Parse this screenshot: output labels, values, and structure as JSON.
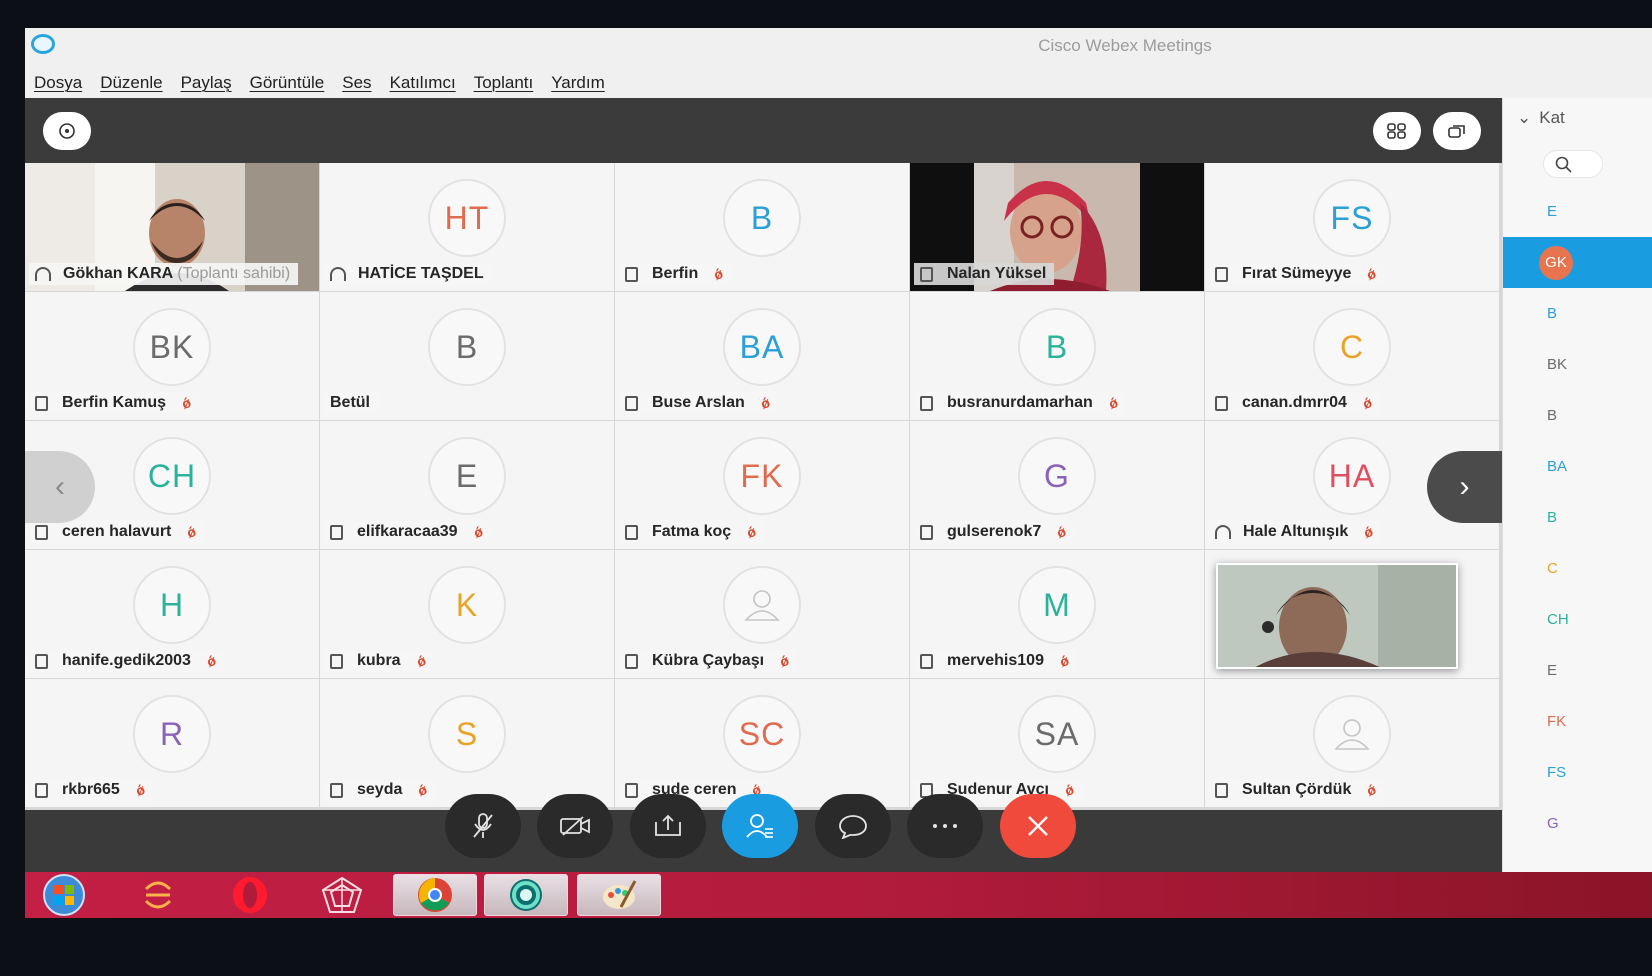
{
  "window": {
    "title": "Cisco Webex Meetings"
  },
  "menu": [
    "Dosya",
    "Düzenle",
    "Paylaş",
    "Görüntüle",
    "Ses",
    "Katılımcı",
    "Toplantı",
    "Yardım"
  ],
  "participants": [
    {
      "name": "Gökhan KARA",
      "note": "(Toplantı sahibi)",
      "kind": "video",
      "icon": "headset-icon",
      "muted": false
    },
    {
      "name": "HATİCE TAŞDEL",
      "initials": "HT",
      "color": "#e06b4f",
      "icon": "headset-icon",
      "muted": false
    },
    {
      "name": "Berfin",
      "initials": "B",
      "color": "#2b9fd6",
      "icon": "phone-icon",
      "muted": true
    },
    {
      "name": "Nalan Yüksel",
      "kind": "video",
      "icon": "phone-icon",
      "muted": false
    },
    {
      "name": "Fırat Sümeyye",
      "initials": "FS",
      "color": "#2b9fd6",
      "icon": "phone-icon",
      "muted": true
    },
    {
      "name": "Berfin Kamuş",
      "initials": "BK",
      "color": "#6b6b6b",
      "icon": "phone-icon",
      "muted": true
    },
    {
      "name": "Betül",
      "initials": "B",
      "color": "#6b6b6b",
      "icon": "",
      "muted": false
    },
    {
      "name": "Buse Arslan",
      "initials": "BA",
      "color": "#2b9fd6",
      "icon": "phone-icon",
      "muted": true
    },
    {
      "name": "busranurdamarhan",
      "initials": "B",
      "color": "#2bb39a",
      "icon": "phone-icon",
      "muted": true
    },
    {
      "name": "canan.dmrr04",
      "initials": "C",
      "color": "#e8a427",
      "icon": "phone-icon",
      "muted": true
    },
    {
      "name": "ceren halavurt",
      "initials": "CH",
      "color": "#2bb39a",
      "icon": "phone-icon",
      "muted": true
    },
    {
      "name": "elifkaracaa39",
      "initials": "E",
      "color": "#6b6b6b",
      "icon": "phone-icon",
      "muted": true
    },
    {
      "name": "Fatma koç",
      "initials": "FK",
      "color": "#e06b4f",
      "icon": "phone-icon",
      "muted": true
    },
    {
      "name": "gulserenok7",
      "initials": "G",
      "color": "#8a62b6",
      "icon": "phone-icon",
      "muted": true
    },
    {
      "name": "Hale Altunışık",
      "initials": "HA",
      "color": "#e04f5f",
      "icon": "headset-icon",
      "muted": true
    },
    {
      "name": "hanife.gedik2003",
      "initials": "H",
      "color": "#2bb39a",
      "icon": "phone-icon",
      "muted": true
    },
    {
      "name": "kubra",
      "initials": "K",
      "color": "#e8a427",
      "icon": "phone-icon",
      "muted": true
    },
    {
      "name": "Kübra Çaybaşı",
      "initials": "",
      "color": "#b8b8b8",
      "icon": "phone-icon",
      "muted": true,
      "placeholder": true
    },
    {
      "name": "mervehis109",
      "initials": "M",
      "color": "#2bb39a",
      "icon": "phone-icon",
      "muted": true
    },
    {
      "name": "",
      "initials": "",
      "color": "#b8b8b8",
      "icon": "",
      "muted": false,
      "hidden": true
    },
    {
      "name": "rkbr665",
      "initials": "R",
      "color": "#8a62b6",
      "icon": "phone-icon",
      "muted": true
    },
    {
      "name": "seyda",
      "initials": "S",
      "color": "#e8a427",
      "icon": "phone-icon",
      "muted": true
    },
    {
      "name": "sude ceren",
      "initials": "SC",
      "color": "#e06b4f",
      "icon": "phone-icon",
      "muted": true
    },
    {
      "name": "Sudenur Avcı",
      "initials": "SA",
      "color": "#6b6b6b",
      "icon": "phone-icon",
      "muted": true
    },
    {
      "name": "Sultan Çördük",
      "initials": "",
      "color": "#b8b8b8",
      "icon": "phone-icon",
      "muted": true,
      "placeholder": true
    }
  ],
  "sidebar": {
    "header": "Kat",
    "items": [
      {
        "label": "E",
        "color": "#2b9fd6"
      },
      {
        "label": "GK",
        "color": "#ffffff",
        "selected": true
      },
      {
        "label": "B",
        "color": "#2b9fd6"
      },
      {
        "label": "BK",
        "color": "#6b6b6b"
      },
      {
        "label": "B",
        "color": "#6b6b6b"
      },
      {
        "label": "BA",
        "color": "#2b9fd6"
      },
      {
        "label": "B",
        "color": "#2bb39a"
      },
      {
        "label": "C",
        "color": "#e8a427"
      },
      {
        "label": "CH",
        "color": "#2bb39a"
      },
      {
        "label": "E",
        "color": "#6b6b6b"
      },
      {
        "label": "FK",
        "color": "#e06b4f"
      },
      {
        "label": "FS",
        "color": "#2b9fd6"
      },
      {
        "label": "G",
        "color": "#8a62b6"
      }
    ]
  },
  "controls": {
    "mute": "mute-microphone-icon",
    "video": "stop-video-icon",
    "share": "share-icon",
    "participants": "participants-icon",
    "chat": "chat-icon",
    "more": "more-icon",
    "end": "end-meeting-icon"
  },
  "colors": {
    "accent": "#1a9de0",
    "end": "#f04a3c",
    "taskbar": "#c41f45"
  }
}
